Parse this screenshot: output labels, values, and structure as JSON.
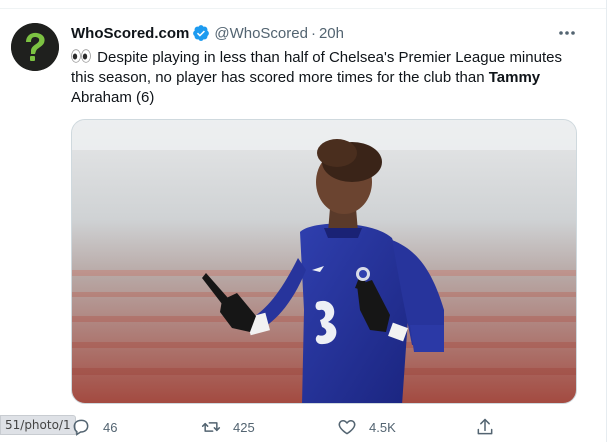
{
  "tweet": {
    "display_name": "WhoScored.com",
    "handle": "@WhoScored",
    "separator": "·",
    "time": "20h",
    "text_before": "Despite playing in less than half of Chelsea's Premier League minutes this season, no player has scored more times for the club than ",
    "text_bold": "Tammy",
    "text_after": " Abraham (6)",
    "media_alt": "Tammy Abraham pointing to the sky",
    "stats": {
      "replies": "46",
      "retweets": "425",
      "likes": "4.5K"
    }
  },
  "browser": {
    "url_fragment": "51/photo/1"
  },
  "icons": {
    "avatar": "whoscored-logo-icon",
    "verified": "verified-badge-icon",
    "more": "more-options-icon",
    "eyes": "eyes-emoji-icon",
    "reply": "reply-icon",
    "retweet": "retweet-icon",
    "like": "heart-icon",
    "share": "share-icon"
  },
  "colors": {
    "accent": "#1d9bf0",
    "logo_green": "#7cc242",
    "secondary_text": "#536471"
  }
}
